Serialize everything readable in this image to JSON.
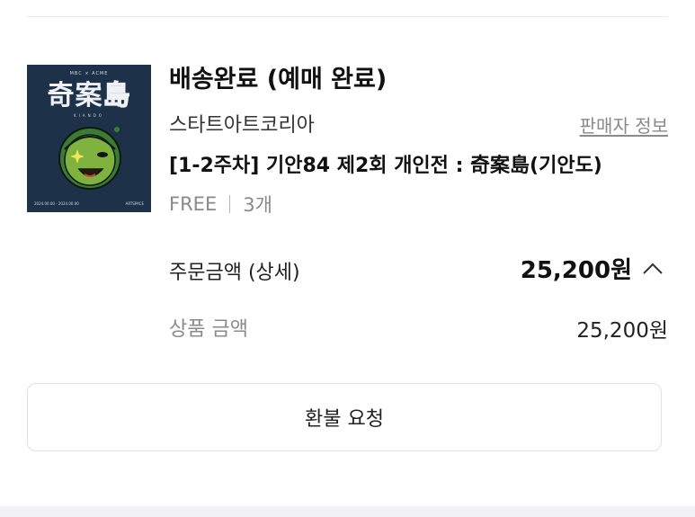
{
  "order": {
    "status": "배송완료 (예매 완료)",
    "seller_name": "스타트아트코리아",
    "seller_info_link": "판매자 정보",
    "product_title": "[1-2주차] 기안84 제2회 개인전 : 奇案島(기안도)",
    "shipping": "FREE",
    "quantity": "3개",
    "thumbnail": {
      "logos": "MBC × ACME",
      "title_main": "奇案",
      "title_outline": "島",
      "subtitle": "KIANDO",
      "date_range": "2024.00.00 - 2024.00.00",
      "venue": "ARTSPACE"
    }
  },
  "summary": {
    "order_amount_label": "주문금액 (상세)",
    "order_amount_value": "25,200원",
    "product_price_label": "상품 금액",
    "product_price_value": "25,200원"
  },
  "actions": {
    "refund_label": "환불 요청"
  },
  "icons": {
    "expand": "chevron-up-icon"
  }
}
